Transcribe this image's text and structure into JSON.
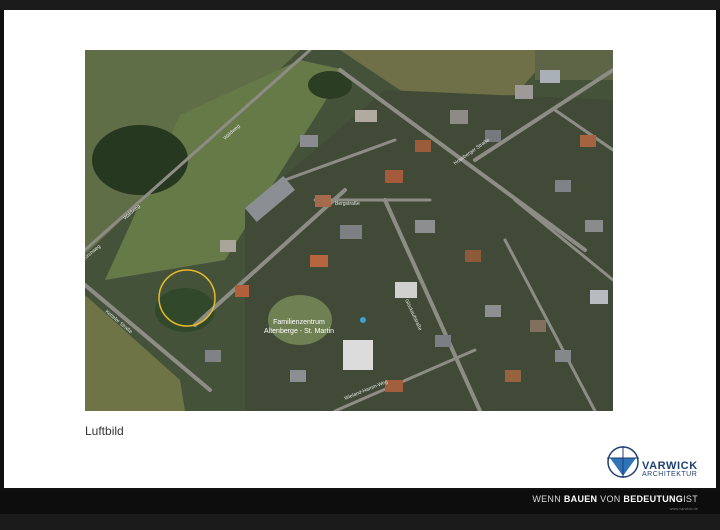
{
  "caption": "Luftbild",
  "map_labels": {
    "poi": "Familienzentrum\nAltenberge - St. Martin",
    "streets": [
      "Waldweg",
      "Waldweg",
      "Kirchweg",
      "Ketteler Straße",
      "Bergstraße",
      "Glückaufstraße",
      "Wieland-Hamm-Weg",
      "Hoseberger Straße"
    ]
  },
  "logo": {
    "name": "VARWICK",
    "sub": "ARCHITEKTUR",
    "color": "#1f3f73"
  },
  "footer": {
    "tagline_w1": "WENN",
    "tagline_w2": "BAUEN",
    "tagline_w3": "VON",
    "tagline_w4": "BEDEUTUNG",
    "tagline_w5": "IST",
    "url": "www.varwick.de"
  },
  "colors": {
    "background": "#111111",
    "slide": "#ffffff",
    "marker": "#e7b92a"
  }
}
